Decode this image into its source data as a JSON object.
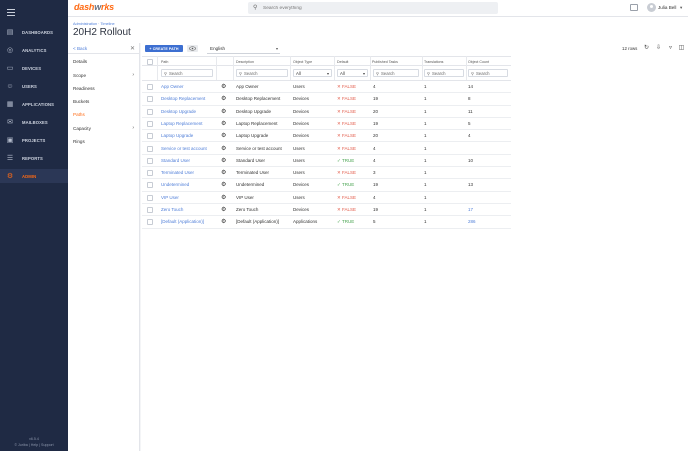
{
  "brand": {
    "part1": "dash",
    "part2": "w",
    "part3": "rks"
  },
  "search": {
    "placeholder": "Search everything"
  },
  "user": {
    "name": "Julia Bell",
    "caret": "▾"
  },
  "nav": {
    "items": [
      {
        "label": "DASHBOARDS",
        "icon": "dashboard-icon",
        "glyph": "▤"
      },
      {
        "label": "ANALYTICS",
        "icon": "analytics-icon",
        "glyph": "◎"
      },
      {
        "label": "DEVICES",
        "icon": "devices-icon",
        "glyph": "▭"
      },
      {
        "label": "USERS",
        "icon": "users-icon",
        "glyph": "☺"
      },
      {
        "label": "APPLICATIONS",
        "icon": "applications-icon",
        "glyph": "▦"
      },
      {
        "label": "MAILBOXES",
        "icon": "mailbox-icon",
        "glyph": "✉"
      },
      {
        "label": "PROJECTS",
        "icon": "projects-icon",
        "glyph": "▣"
      },
      {
        "label": "REPORTS",
        "icon": "reports-icon",
        "glyph": "☰"
      },
      {
        "label": "ADMIN",
        "icon": "gear-icon",
        "glyph": "⚙",
        "active": true
      }
    ],
    "version": "v6.5.4",
    "footer": "© Juriba | Help | Support"
  },
  "header": {
    "breadcrumb": "Administration · Timeline",
    "title": "20H2 Rollout"
  },
  "subnav": {
    "back_label": "< Back",
    "close_glyph": "✕",
    "items": [
      {
        "label": "Details",
        "chevron": ""
      },
      {
        "label": "Scope",
        "chevron": "›"
      },
      {
        "label": "Readiness",
        "chevron": ""
      },
      {
        "label": "Buckets",
        "chevron": ""
      },
      {
        "label": "Paths",
        "chevron": "",
        "active": true
      },
      {
        "label": "Capacity",
        "chevron": "›"
      },
      {
        "label": "Rings",
        "chevron": ""
      }
    ]
  },
  "toolbar": {
    "create_label": "+ CREATE PATH",
    "language": "English",
    "caret": "▾",
    "rows": "12 rows",
    "icons": [
      "refresh-icon",
      "download-icon",
      "filter-icon",
      "columns-icon"
    ],
    "icon_glyphs": [
      "↻",
      "⇩",
      "▿",
      "◫"
    ]
  },
  "table": {
    "headers": [
      "Path",
      "Description",
      "Object Type",
      "Default",
      "Published Tasks",
      "Translations",
      "Object Count"
    ],
    "filters": {
      "search_placeholder": "Search",
      "magnifier": "⚲",
      "object_type": "All",
      "default": "All",
      "caret": "▾"
    },
    "gear_glyph": "⚙",
    "rows": [
      {
        "path": "App Owner",
        "description": "App Owner",
        "type": "Users",
        "default": "✕ FALSE",
        "is_default": false,
        "tasks": "4",
        "translations": "1",
        "count": "14",
        "count_link": false
      },
      {
        "path": "Desktop Replacement",
        "description": "Desktop Replacement",
        "type": "Devices",
        "default": "✕ FALSE",
        "is_default": false,
        "tasks": "19",
        "translations": "1",
        "count": "8",
        "count_link": false
      },
      {
        "path": "Desktop Upgrade",
        "description": "Desktop Upgrade",
        "type": "Devices",
        "default": "✕ FALSE",
        "is_default": false,
        "tasks": "20",
        "translations": "1",
        "count": "11",
        "count_link": false
      },
      {
        "path": "Laptop Replacement",
        "description": "Laptop Replacement",
        "type": "Devices",
        "default": "✕ FALSE",
        "is_default": false,
        "tasks": "19",
        "translations": "1",
        "count": "5",
        "count_link": false
      },
      {
        "path": "Laptop Upgrade",
        "description": "Laptop Upgrade",
        "type": "Devices",
        "default": "✕ FALSE",
        "is_default": false,
        "tasks": "20",
        "translations": "1",
        "count": "4",
        "count_link": false
      },
      {
        "path": "Service or test account",
        "description": "Service or test account",
        "type": "Users",
        "default": "✕ FALSE",
        "is_default": false,
        "tasks": "4",
        "translations": "1",
        "count": "",
        "count_link": false
      },
      {
        "path": "Standard User",
        "description": "Standard User",
        "type": "Users",
        "default": "✓ TRUE",
        "is_default": true,
        "tasks": "4",
        "translations": "1",
        "count": "10",
        "count_link": false
      },
      {
        "path": "Terminated User",
        "description": "Terminated User",
        "type": "Users",
        "default": "✕ FALSE",
        "is_default": false,
        "tasks": "3",
        "translations": "1",
        "count": "",
        "count_link": false
      },
      {
        "path": "Undetermined",
        "description": "Undetermined",
        "type": "Devices",
        "default": "✓ TRUE",
        "is_default": true,
        "tasks": "19",
        "translations": "1",
        "count": "13",
        "count_link": false
      },
      {
        "path": "VIP User",
        "description": "VIP User",
        "type": "Users",
        "default": "✕ FALSE",
        "is_default": false,
        "tasks": "4",
        "translations": "1",
        "count": "",
        "count_link": false
      },
      {
        "path": "Zero Touch",
        "description": "Zero Touch",
        "type": "Devices",
        "default": "✕ FALSE",
        "is_default": false,
        "tasks": "19",
        "translations": "1",
        "count": "17",
        "count_link": true
      },
      {
        "path": "[Default (Application)]",
        "description": "[Default (Application)]",
        "type": "Applications",
        "default": "✓ TRUE",
        "is_default": true,
        "tasks": "5",
        "translations": "1",
        "count": "286",
        "count_link": true
      }
    ]
  },
  "colors": {
    "accent": "#ff6a13",
    "nav_bg": "#1f2a44",
    "link": "#4f7ed8",
    "false": "#e25b4a",
    "true": "#46a24e",
    "primary_button": "#3d6fd1"
  }
}
